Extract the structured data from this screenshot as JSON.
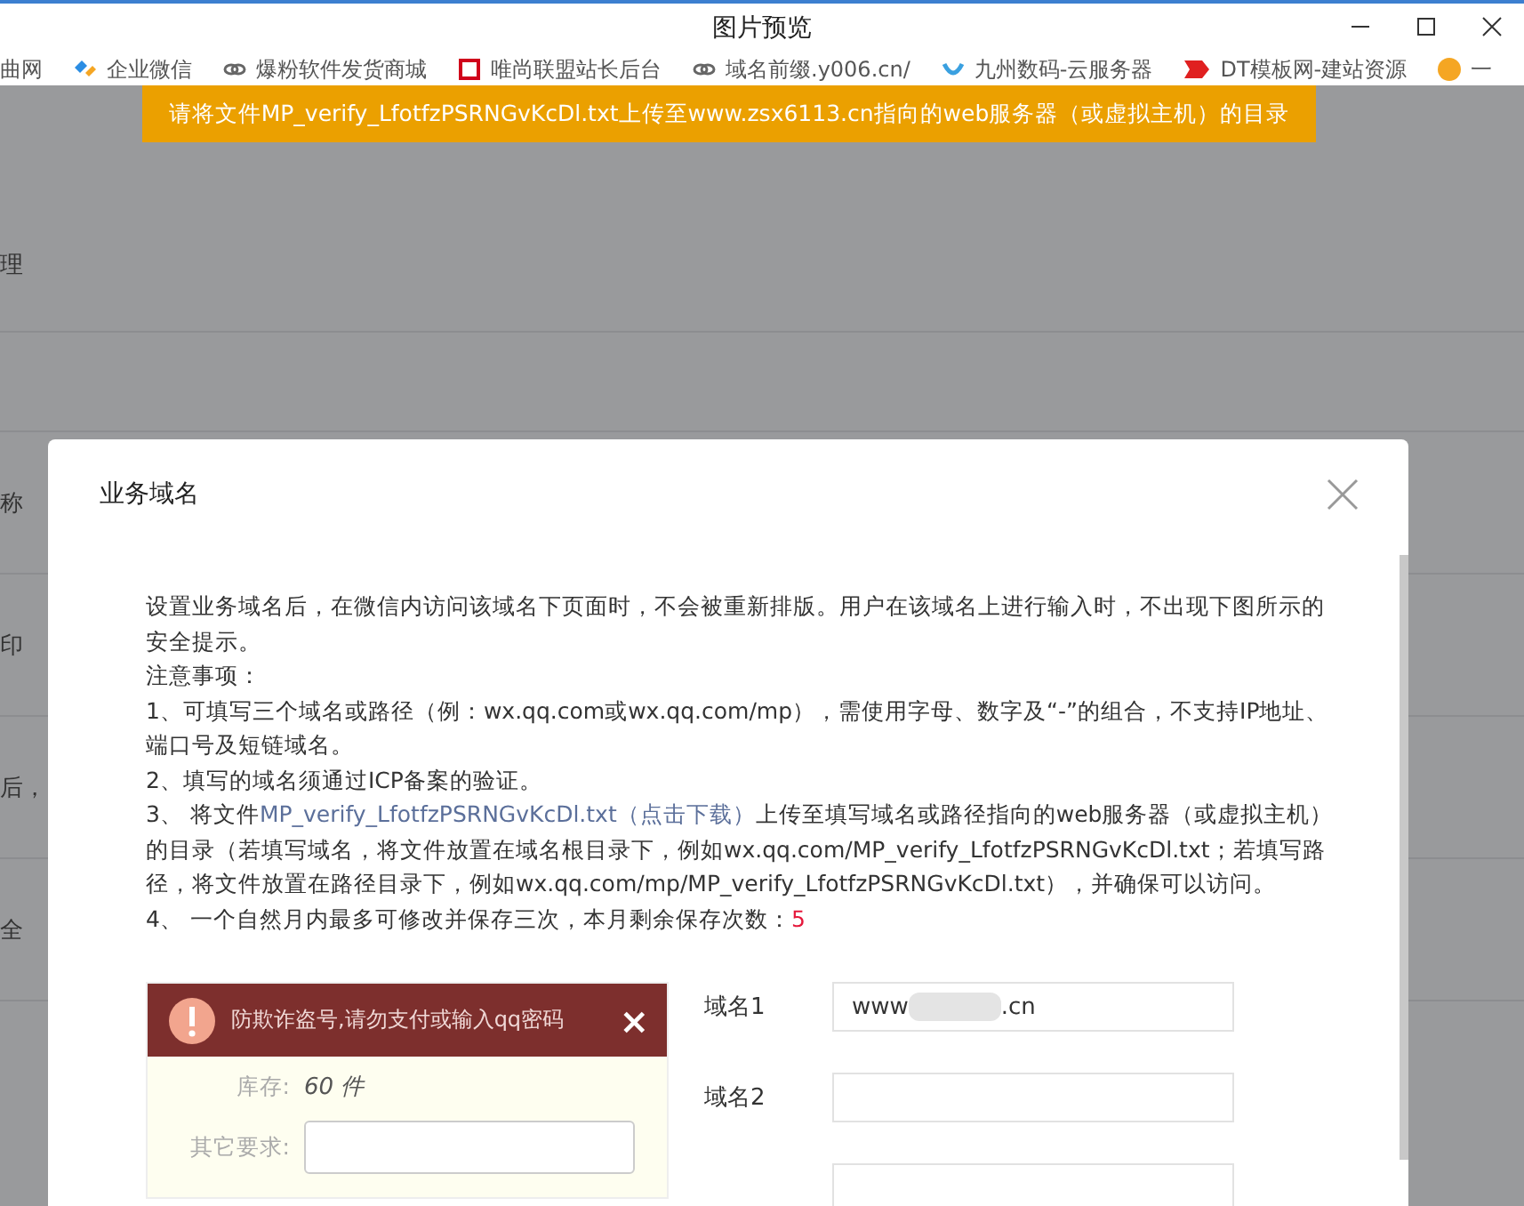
{
  "window": {
    "title": "图片预览",
    "controls": [
      {
        "kind": "minimize"
      },
      {
        "kind": "maximize"
      },
      {
        "kind": "close"
      }
    ]
  },
  "bookmarks": [
    {
      "label": "曲网",
      "kind": "plain"
    },
    {
      "label": "企业微信",
      "kind": "wechat"
    },
    {
      "label": "爆粉软件发货商城",
      "kind": "link"
    },
    {
      "label": "唯尚联盟站长后台",
      "kind": "badge"
    },
    {
      "label": "域名前缀.y006.cn/",
      "kind": "link"
    },
    {
      "label": "九州数码-云服务器",
      "kind": "swirl"
    },
    {
      "label": "DT模板网-建站资源",
      "kind": "dt"
    },
    {
      "label": "一",
      "kind": "face"
    }
  ],
  "banner": "请将文件MP_verify_LfotfzPSRNGvKcDl.txt上传至www.zsx6113.cn指向的web服务器（或虚拟主机）的目录",
  "background_rows": [
    "理",
    "",
    "称",
    "印",
    "后，",
    "全"
  ],
  "dialog": {
    "title": "业务域名",
    "paragraphs": [
      {
        "text": "设置业务域名后，在微信内访问该域名下页面时，不会被重新排版。用户在该域名上进行输入时，不出现下图所示的安全提示。"
      },
      {
        "text": "注意事项："
      },
      {
        "text": "1、可填写三个域名或路径（例：wx.qq.com或wx.qq.com/mp），需使用字母、数字及“-”的组合，不支持IP地址、端口号及短链域名。"
      },
      {
        "text": "2、填写的域名须通过ICP备案的验证。"
      },
      {
        "prefix": "3、 将文件",
        "link": "MP_verify_LfotfzPSRNGvKcDl.txt（点击下载）",
        "text": "上传至填写域名或路径指向的web服务器（或虚拟主机）的目录（若填写域名，将文件放置在域名根目录下，例如wx.qq.com/MP_verify_LfotfzPSRNGvKcDl.txt；若填写路径，将文件放置在路径目录下，例如wx.qq.com/mp/MP_verify_LfotfzPSRNGvKcDl.txt），并确保可以访问。"
      },
      {
        "text": "4、 一个自然月内最多可修改并保存三次，本月剩余保存次数：",
        "count": "5"
      }
    ],
    "example": {
      "warning": "防欺诈盗号,请勿支付或输入qq密码",
      "close": "×",
      "stock_label": "库存:",
      "stock_value": "60 件",
      "other_label": "其它要求:"
    },
    "fields": [
      {
        "label": "域名1",
        "value_start": "www",
        "value_end": ".cn",
        "redacted": true
      },
      {
        "label": "域名2",
        "redacted": false
      },
      {
        "redacted": false
      }
    ]
  }
}
